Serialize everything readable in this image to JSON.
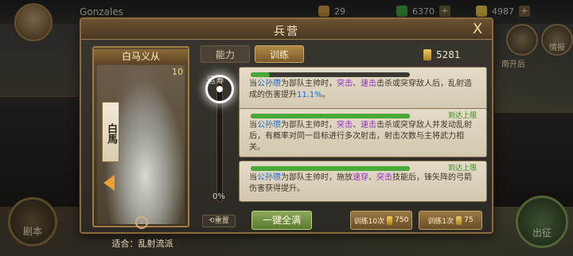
{
  "player": {
    "name": "Gonzales"
  },
  "resources": [
    {
      "icon": "copper-icon",
      "value": "29",
      "color": "#c09040"
    },
    {
      "icon": "jade-icon",
      "value": "6370",
      "color": "#40a040"
    },
    {
      "icon": "gold-icon",
      "value": "4987",
      "color": "#e0c040"
    }
  ],
  "background": {
    "left_button": "剧本",
    "right_button": "出征",
    "right_label_1": "南开后",
    "right_label_2": "情报"
  },
  "dialog": {
    "title": "兵营",
    "close_label": "X",
    "tabs": [
      {
        "label": "能力"
      },
      {
        "label": "训练"
      }
    ],
    "coin_value": "5281"
  },
  "hero": {
    "name": "白马义从",
    "level": "10",
    "banner": "白馬",
    "suit": "适合：乱射流派"
  },
  "slider": {
    "top_label": "运筹",
    "value_label": "0%",
    "value": 0
  },
  "skills": [
    {
      "max_label": "",
      "progress": 0.12,
      "pre": "当",
      "name": "公孙瓒",
      "mid1": "为部队主帅时，",
      "kw1": "突击",
      "sep": "、",
      "kw2": "速击",
      "mid2": "击杀或突穿敌人后，乱射造成的伤害提升",
      "kw3": "11.1%",
      "post": "。"
    },
    {
      "max_label": "到达上限",
      "progress": 1,
      "pre": "当",
      "name": "公孙瓒",
      "mid1": "为部队主帅时，",
      "kw1": "突击",
      "sep": "、",
      "kw2": "速击",
      "mid2": "击杀或突穿敌人并发动乱射后，有概率对同一目标进行多次射击，射击次数与主将武力相关。",
      "kw3": "",
      "post": ""
    },
    {
      "max_label": "到达上限",
      "progress": 1,
      "pre": "当",
      "name": "公孙瓒",
      "mid1": "为部队主帅时，施放",
      "kw1": "速穿",
      "sep": "、",
      "kw2": "突击",
      "mid2": "技能后，锋矢阵的弓箭伤害获得提升。",
      "kw3": "",
      "post": ""
    }
  ],
  "buttons": {
    "reset": "重置",
    "full": "一键全满",
    "train10": "训练10次",
    "train10_cost": "750",
    "train1": "训练1次",
    "train1_cost": "75"
  }
}
